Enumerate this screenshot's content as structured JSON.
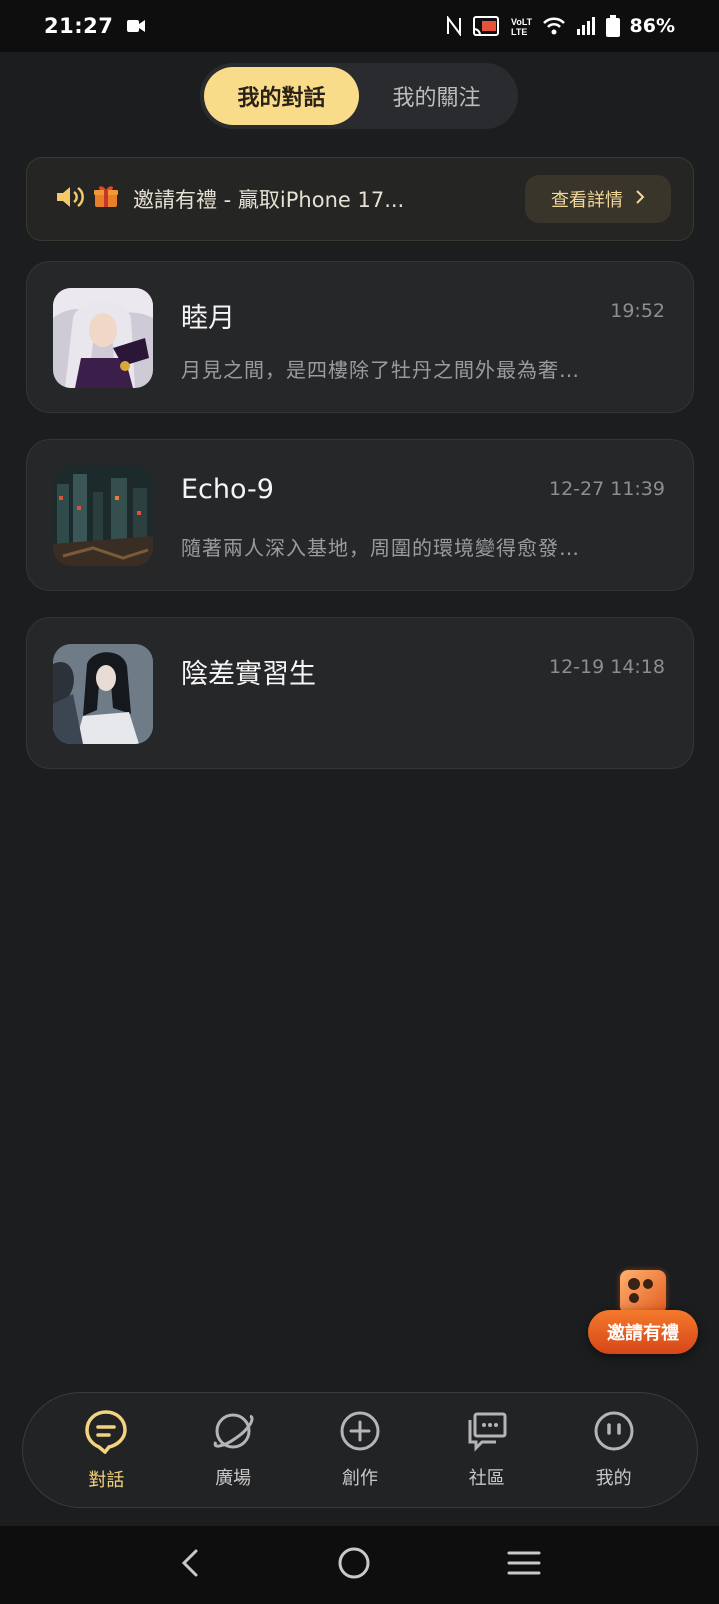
{
  "status_bar": {
    "time": "21:27",
    "battery": "86%"
  },
  "tabs": [
    {
      "label": "我的對話",
      "active": true
    },
    {
      "label": "我的關注",
      "active": false
    }
  ],
  "banner": {
    "text": "邀請有禮 - 贏取iPhone 17...",
    "button_label": "查看詳情"
  },
  "chats": [
    {
      "name": "睦月",
      "time": "19:52",
      "preview": "月見之間，是四樓除了牡丹之間外最為奢…"
    },
    {
      "name": "Echo-9",
      "time": "12-27 11:39",
      "preview": "隨著兩人深入基地，周圍的環境變得愈發…"
    },
    {
      "name": "陰差實習生",
      "time": "12-19 14:18",
      "preview": ""
    }
  ],
  "float_invite": {
    "label": "邀請有禮"
  },
  "bottom_nav": [
    {
      "label": "對話",
      "icon": "chat-icon",
      "active": true
    },
    {
      "label": "廣場",
      "icon": "planet-icon",
      "active": false
    },
    {
      "label": "創作",
      "icon": "plus-circle-icon",
      "active": false
    },
    {
      "label": "社區",
      "icon": "community-icon",
      "active": false
    },
    {
      "label": "我的",
      "icon": "profile-face-icon",
      "active": false
    }
  ],
  "colors": {
    "accent": "#f8dc8a",
    "background": "#1c1d1f",
    "invite_orange": "#e8561f"
  }
}
